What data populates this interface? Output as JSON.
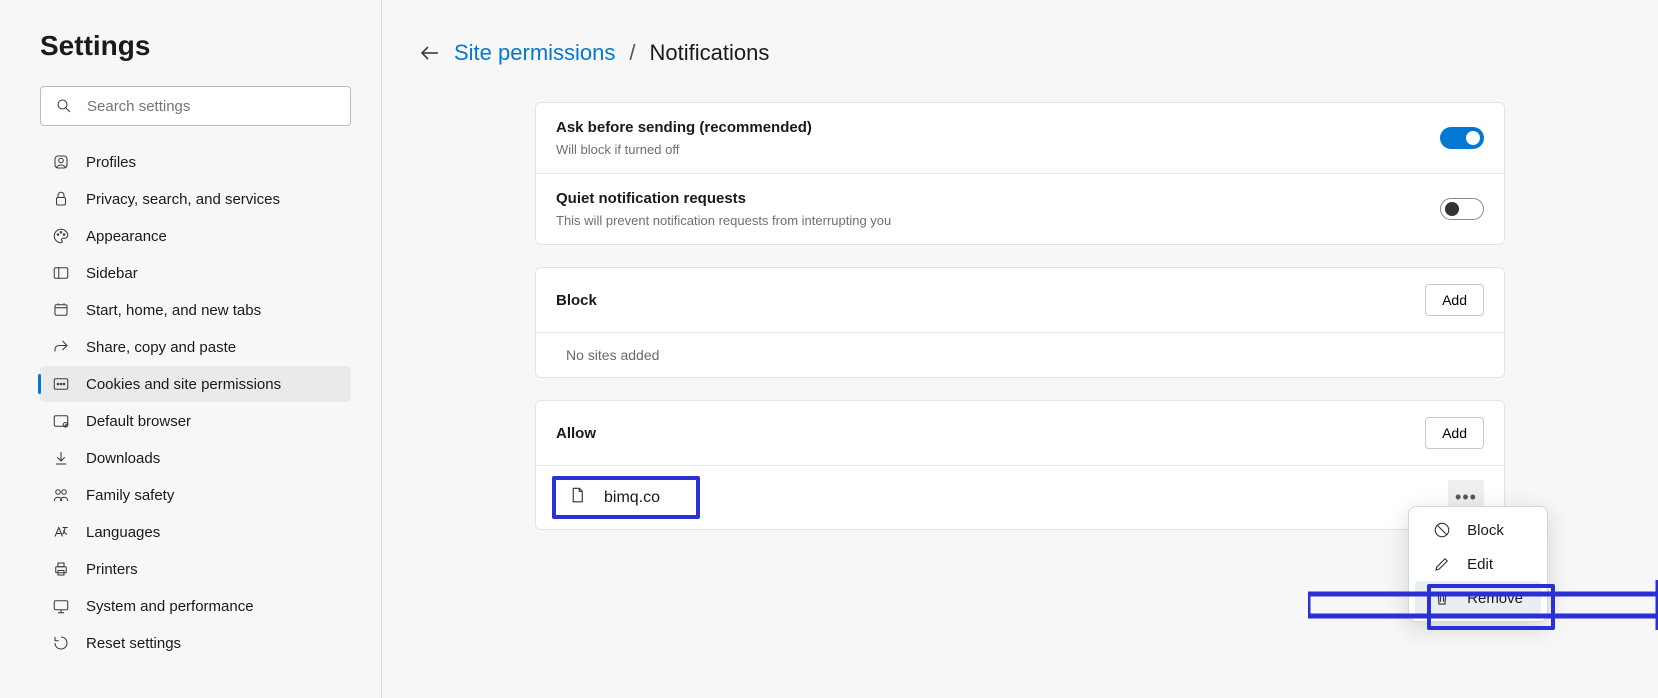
{
  "sidebar": {
    "title": "Settings",
    "search_placeholder": "Search settings",
    "items": [
      {
        "label": "Profiles",
        "icon": "profile-icon"
      },
      {
        "label": "Privacy, search, and services",
        "icon": "lock-icon"
      },
      {
        "label": "Appearance",
        "icon": "palette-icon"
      },
      {
        "label": "Sidebar",
        "icon": "sidebar-icon"
      },
      {
        "label": "Start, home, and new tabs",
        "icon": "home-icon"
      },
      {
        "label": "Share, copy and paste",
        "icon": "share-icon"
      },
      {
        "label": "Cookies and site permissions",
        "icon": "cookie-icon"
      },
      {
        "label": "Default browser",
        "icon": "browser-icon"
      },
      {
        "label": "Downloads",
        "icon": "download-icon"
      },
      {
        "label": "Family safety",
        "icon": "family-icon"
      },
      {
        "label": "Languages",
        "icon": "language-icon"
      },
      {
        "label": "Printers",
        "icon": "printer-icon"
      },
      {
        "label": "System and performance",
        "icon": "system-icon"
      },
      {
        "label": "Reset settings",
        "icon": "reset-icon"
      }
    ],
    "active_index": 6
  },
  "breadcrumb": {
    "link_text": "Site permissions",
    "current": "Notifications"
  },
  "settings_card": {
    "ask": {
      "title": "Ask before sending (recommended)",
      "desc": "Will block if turned off",
      "on": true
    },
    "quiet": {
      "title": "Quiet notification requests",
      "desc": "This will prevent notification requests from interrupting you",
      "on": false
    }
  },
  "block_section": {
    "title": "Block",
    "add_label": "Add",
    "empty": "No sites added"
  },
  "allow_section": {
    "title": "Allow",
    "add_label": "Add",
    "sites": [
      {
        "name": "bimq.co"
      }
    ]
  },
  "context_menu": {
    "block": "Block",
    "edit": "Edit",
    "remove": "Remove"
  }
}
